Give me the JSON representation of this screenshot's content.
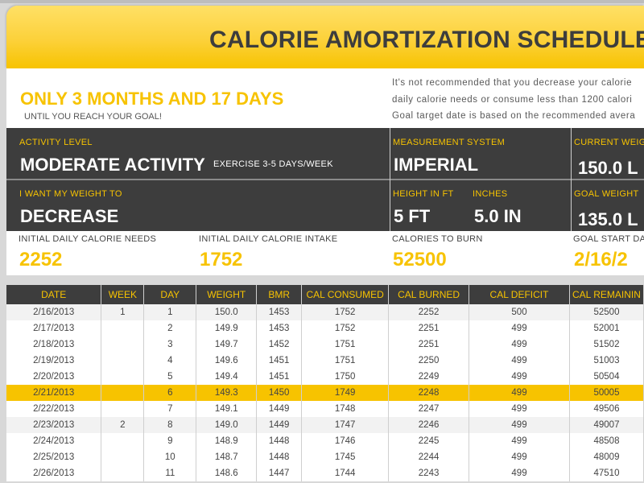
{
  "title": "CALORIE AMORTIZATION SCHEDULE",
  "countdown": {
    "headline": "ONLY 3 MONTHS AND 17 DAYS",
    "subtext": "UNTIL YOU REACH YOUR GOAL!"
  },
  "notes": [
    "It's not recommended that you decrease your calorie",
    "daily calorie needs or consume less than 1200 calori",
    "Goal target date is based on the recommended avera"
  ],
  "inputs": {
    "activity_level": {
      "label": "ACTIVITY LEVEL",
      "value": "MODERATE ACTIVITY",
      "description": "EXERCISE 3-5 DAYS/WEEK"
    },
    "measurement_system": {
      "label": "MEASUREMENT SYSTEM",
      "value": "IMPERIAL"
    },
    "current_weight": {
      "label": "CURRENT WEIG",
      "value": "150.0 L"
    },
    "weight_direction": {
      "label": "I WANT MY WEIGHT TO",
      "value": "DECREASE"
    },
    "height_ft": {
      "label": "HEIGHT IN FT",
      "value": "5 FT"
    },
    "height_in": {
      "label": "INCHES",
      "value": "5.0 IN"
    },
    "goal_weight": {
      "label": "GOAL WEIGHT",
      "value": "135.0 L"
    }
  },
  "summary": {
    "daily_needs": {
      "label": "INITIAL DAILY CALORIE NEEDS",
      "value": "2252"
    },
    "daily_intake": {
      "label": "INITIAL DAILY CALORIE INTAKE",
      "value": "1752"
    },
    "calories_to_burn": {
      "label": "CALORIES TO BURN",
      "value": "52500"
    },
    "goal_start_date": {
      "label": "GOAL START DA",
      "value": "2/16/2"
    }
  },
  "table": {
    "headers": [
      "DATE",
      "WEEK",
      "DAY",
      "WEIGHT",
      "BMR",
      "CAL CONSUMED",
      "CAL BURNED",
      "CAL DEFICIT",
      "CAL REMAININ"
    ],
    "highlight_row_index": 5,
    "rows": [
      [
        "2/16/2013",
        "1",
        "1",
        "150.0",
        "1453",
        "1752",
        "2252",
        "500",
        "52500"
      ],
      [
        "2/17/2013",
        "",
        "2",
        "149.9",
        "1453",
        "1752",
        "2251",
        "499",
        "52001"
      ],
      [
        "2/18/2013",
        "",
        "3",
        "149.7",
        "1452",
        "1751",
        "2251",
        "499",
        "51502"
      ],
      [
        "2/19/2013",
        "",
        "4",
        "149.6",
        "1451",
        "1751",
        "2250",
        "499",
        "51003"
      ],
      [
        "2/20/2013",
        "",
        "5",
        "149.4",
        "1451",
        "1750",
        "2249",
        "499",
        "50504"
      ],
      [
        "2/21/2013",
        "",
        "6",
        "149.3",
        "1450",
        "1749",
        "2248",
        "499",
        "50005"
      ],
      [
        "2/22/2013",
        "",
        "7",
        "149.1",
        "1449",
        "1748",
        "2247",
        "499",
        "49506"
      ],
      [
        "2/23/2013",
        "2",
        "8",
        "149.0",
        "1449",
        "1747",
        "2246",
        "499",
        "49007"
      ],
      [
        "2/24/2013",
        "",
        "9",
        "148.9",
        "1448",
        "1746",
        "2245",
        "499",
        "48508"
      ],
      [
        "2/25/2013",
        "",
        "10",
        "148.7",
        "1448",
        "1745",
        "2244",
        "499",
        "48009"
      ],
      [
        "2/26/2013",
        "",
        "11",
        "148.6",
        "1447",
        "1744",
        "2243",
        "499",
        "47510"
      ]
    ]
  }
}
